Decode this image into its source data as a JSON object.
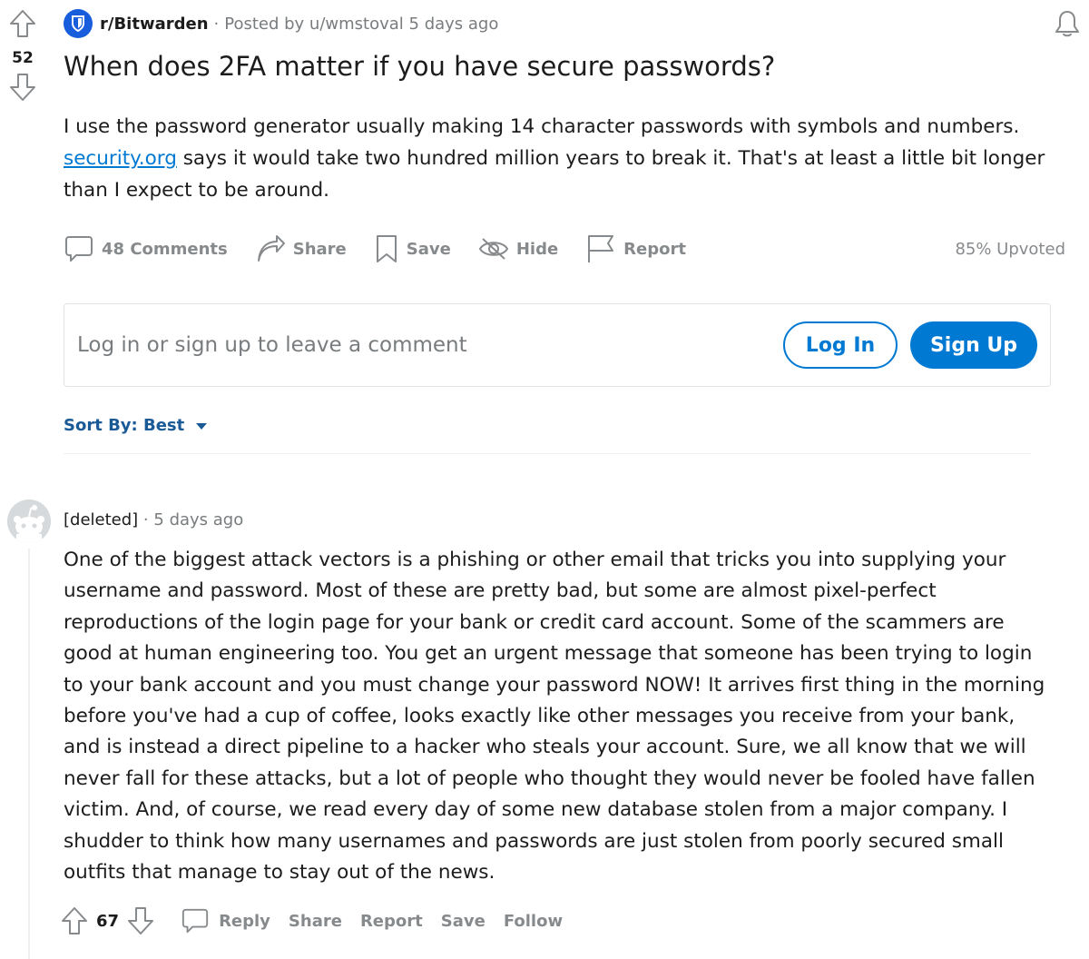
{
  "post": {
    "score": "52",
    "subreddit": "r/Bitwarden",
    "meta_prefix": "·",
    "posted_by": "Posted by u/wmstoval 5 days ago",
    "title": "When does 2FA matter if you have secure passwords?",
    "body_before_link": "I use the password generator usually making 14 character passwords with symbols and numbers.",
    "link_text": "security.org",
    "body_after_link": " says it would take two hundred million years to break it. That's at least a little bit longer than I expect to be around."
  },
  "actions": {
    "comments": "48 Comments",
    "share": "Share",
    "save": "Save",
    "hide": "Hide",
    "report": "Report",
    "upvoted": "85% Upvoted"
  },
  "login": {
    "prompt": "Log in or sign up to leave a comment",
    "login_label": "Log In",
    "signup_label": "Sign Up"
  },
  "sort": {
    "label": "Sort By: Best"
  },
  "comment": {
    "author": "[deleted]",
    "dot": "·",
    "time": "5 days ago",
    "body": "One of the biggest attack vectors is a phishing or other email that tricks you into supplying your username and password. Most of these are pretty bad, but some are almost pixel-perfect reproductions of the login page for your bank or credit card account. Some of the scammers are good at human engineering too. You get an urgent message that someone has been trying to login to your bank account and you must change your password NOW! It arrives first thing in the morning before you've had a cup of coffee, looks exactly like other messages you receive from your bank, and is instead a direct pipeline to a hacker who steals your account. Sure, we all know that we will never fall for these attacks, but a lot of people who thought they would never be fooled have fallen victim. And, of course, we read every day of some new database stolen from a major company. I shudder to think how many usernames and passwords are just stolen from poorly secured small outfits that manage to stay out of the news.",
    "score": "67",
    "reply": "Reply",
    "share": "Share",
    "report": "Report",
    "save": "Save",
    "follow": "Follow"
  },
  "icons": {
    "upvote": "upvote-arrow-icon",
    "downvote": "downvote-arrow-icon",
    "subreddit": "bitwarden-shield-icon",
    "bell": "bell-icon",
    "comment": "comment-bubble-icon",
    "share": "share-arrow-icon",
    "save": "bookmark-icon",
    "hide": "eye-slash-icon",
    "report": "flag-icon",
    "caret": "caret-down-icon",
    "avatar": "snoo-avatar-icon"
  },
  "colors": {
    "accent": "#0079d3",
    "sort": "#1a5a96",
    "muted": "#878a8c",
    "subreddit_icon": "#175ddc"
  }
}
